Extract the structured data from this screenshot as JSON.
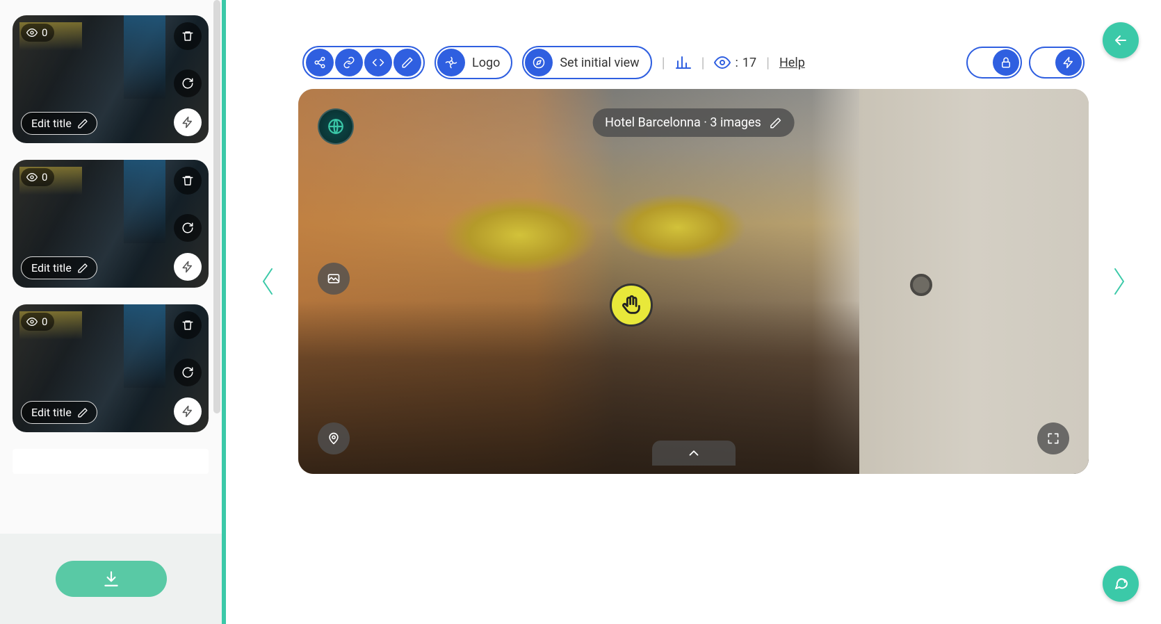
{
  "sidebar": {
    "thumbs": [
      {
        "views": "0",
        "edit_label": "Edit title"
      },
      {
        "views": "0",
        "edit_label": "Edit title"
      },
      {
        "views": "0",
        "edit_label": "Edit title"
      }
    ]
  },
  "toolbar": {
    "logo_label": "Logo",
    "set_view_label": "Set initial view",
    "views_prefix": ":",
    "views_count": "17",
    "help_label": "Help"
  },
  "viewer": {
    "title": "Hotel Barcelonna · 3 images"
  },
  "colors": {
    "accent_teal": "#3bc9a8",
    "accent_blue": "#2f5fe0"
  }
}
